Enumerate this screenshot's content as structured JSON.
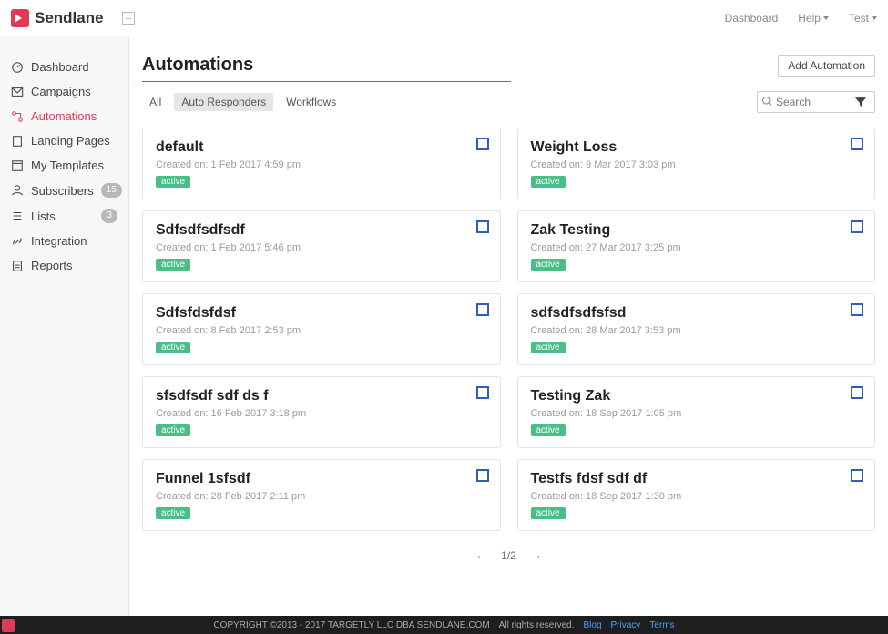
{
  "brand": {
    "name": "Sendlane"
  },
  "topnav": {
    "dashboard": "Dashboard",
    "help": "Help",
    "user": "Test"
  },
  "sidebar": {
    "items": [
      {
        "label": "Dashboard",
        "active": false
      },
      {
        "label": "Campaigns",
        "active": false
      },
      {
        "label": "Automations",
        "active": true
      },
      {
        "label": "Landing Pages",
        "active": false
      },
      {
        "label": "My Templates",
        "active": false
      },
      {
        "label": "Subscribers",
        "active": false,
        "badge": "15"
      },
      {
        "label": "Lists",
        "active": false,
        "badge": "3"
      },
      {
        "label": "Integration",
        "active": false
      },
      {
        "label": "Reports",
        "active": false
      }
    ]
  },
  "page": {
    "title": "Automations",
    "add_button": "Add Automation",
    "tabs": [
      {
        "label": "All",
        "active": false
      },
      {
        "label": "Auto Responders",
        "active": true
      },
      {
        "label": "Workflows",
        "active": false
      }
    ],
    "search_placeholder": "Search",
    "created_label": "Created on: ",
    "cards": [
      {
        "title": "default",
        "created": "1 Feb 2017 4:59 pm",
        "status": "active"
      },
      {
        "title": "Weight Loss",
        "created": "9 Mar 2017 3:03 pm",
        "status": "active"
      },
      {
        "title": "Sdfsdfsdfsdf",
        "created": "1 Feb 2017 5:46 pm",
        "status": "active"
      },
      {
        "title": "Zak Testing",
        "created": "27 Mar 2017 3:25 pm",
        "status": "active"
      },
      {
        "title": "Sdfsfdsfdsf",
        "created": "8 Feb 2017 2:53 pm",
        "status": "active"
      },
      {
        "title": "sdfsdfsdfsfsd",
        "created": "28 Mar 2017 3:53 pm",
        "status": "active"
      },
      {
        "title": "sfsdfsdf sdf ds f",
        "created": "16 Feb 2017 3:18 pm",
        "status": "active"
      },
      {
        "title": "Testing Zak",
        "created": "18 Sep 2017 1:05 pm",
        "status": "active"
      },
      {
        "title": "Funnel 1sfsdf",
        "created": "28 Feb 2017 2:11 pm",
        "status": "active"
      },
      {
        "title": "Testfs fdsf sdf df",
        "created": "18 Sep 2017 1:30 pm",
        "status": "active"
      }
    ],
    "pagination": {
      "label": "1/2"
    }
  },
  "footer": {
    "copyright": "COPYRIGHT ©2013 - 2017 TARGETLY LLC DBA SENDLANE.COM",
    "rights": "All rights reserved.",
    "links": {
      "blog": "Blog",
      "privacy": "Privacy",
      "terms": "Terms"
    }
  }
}
